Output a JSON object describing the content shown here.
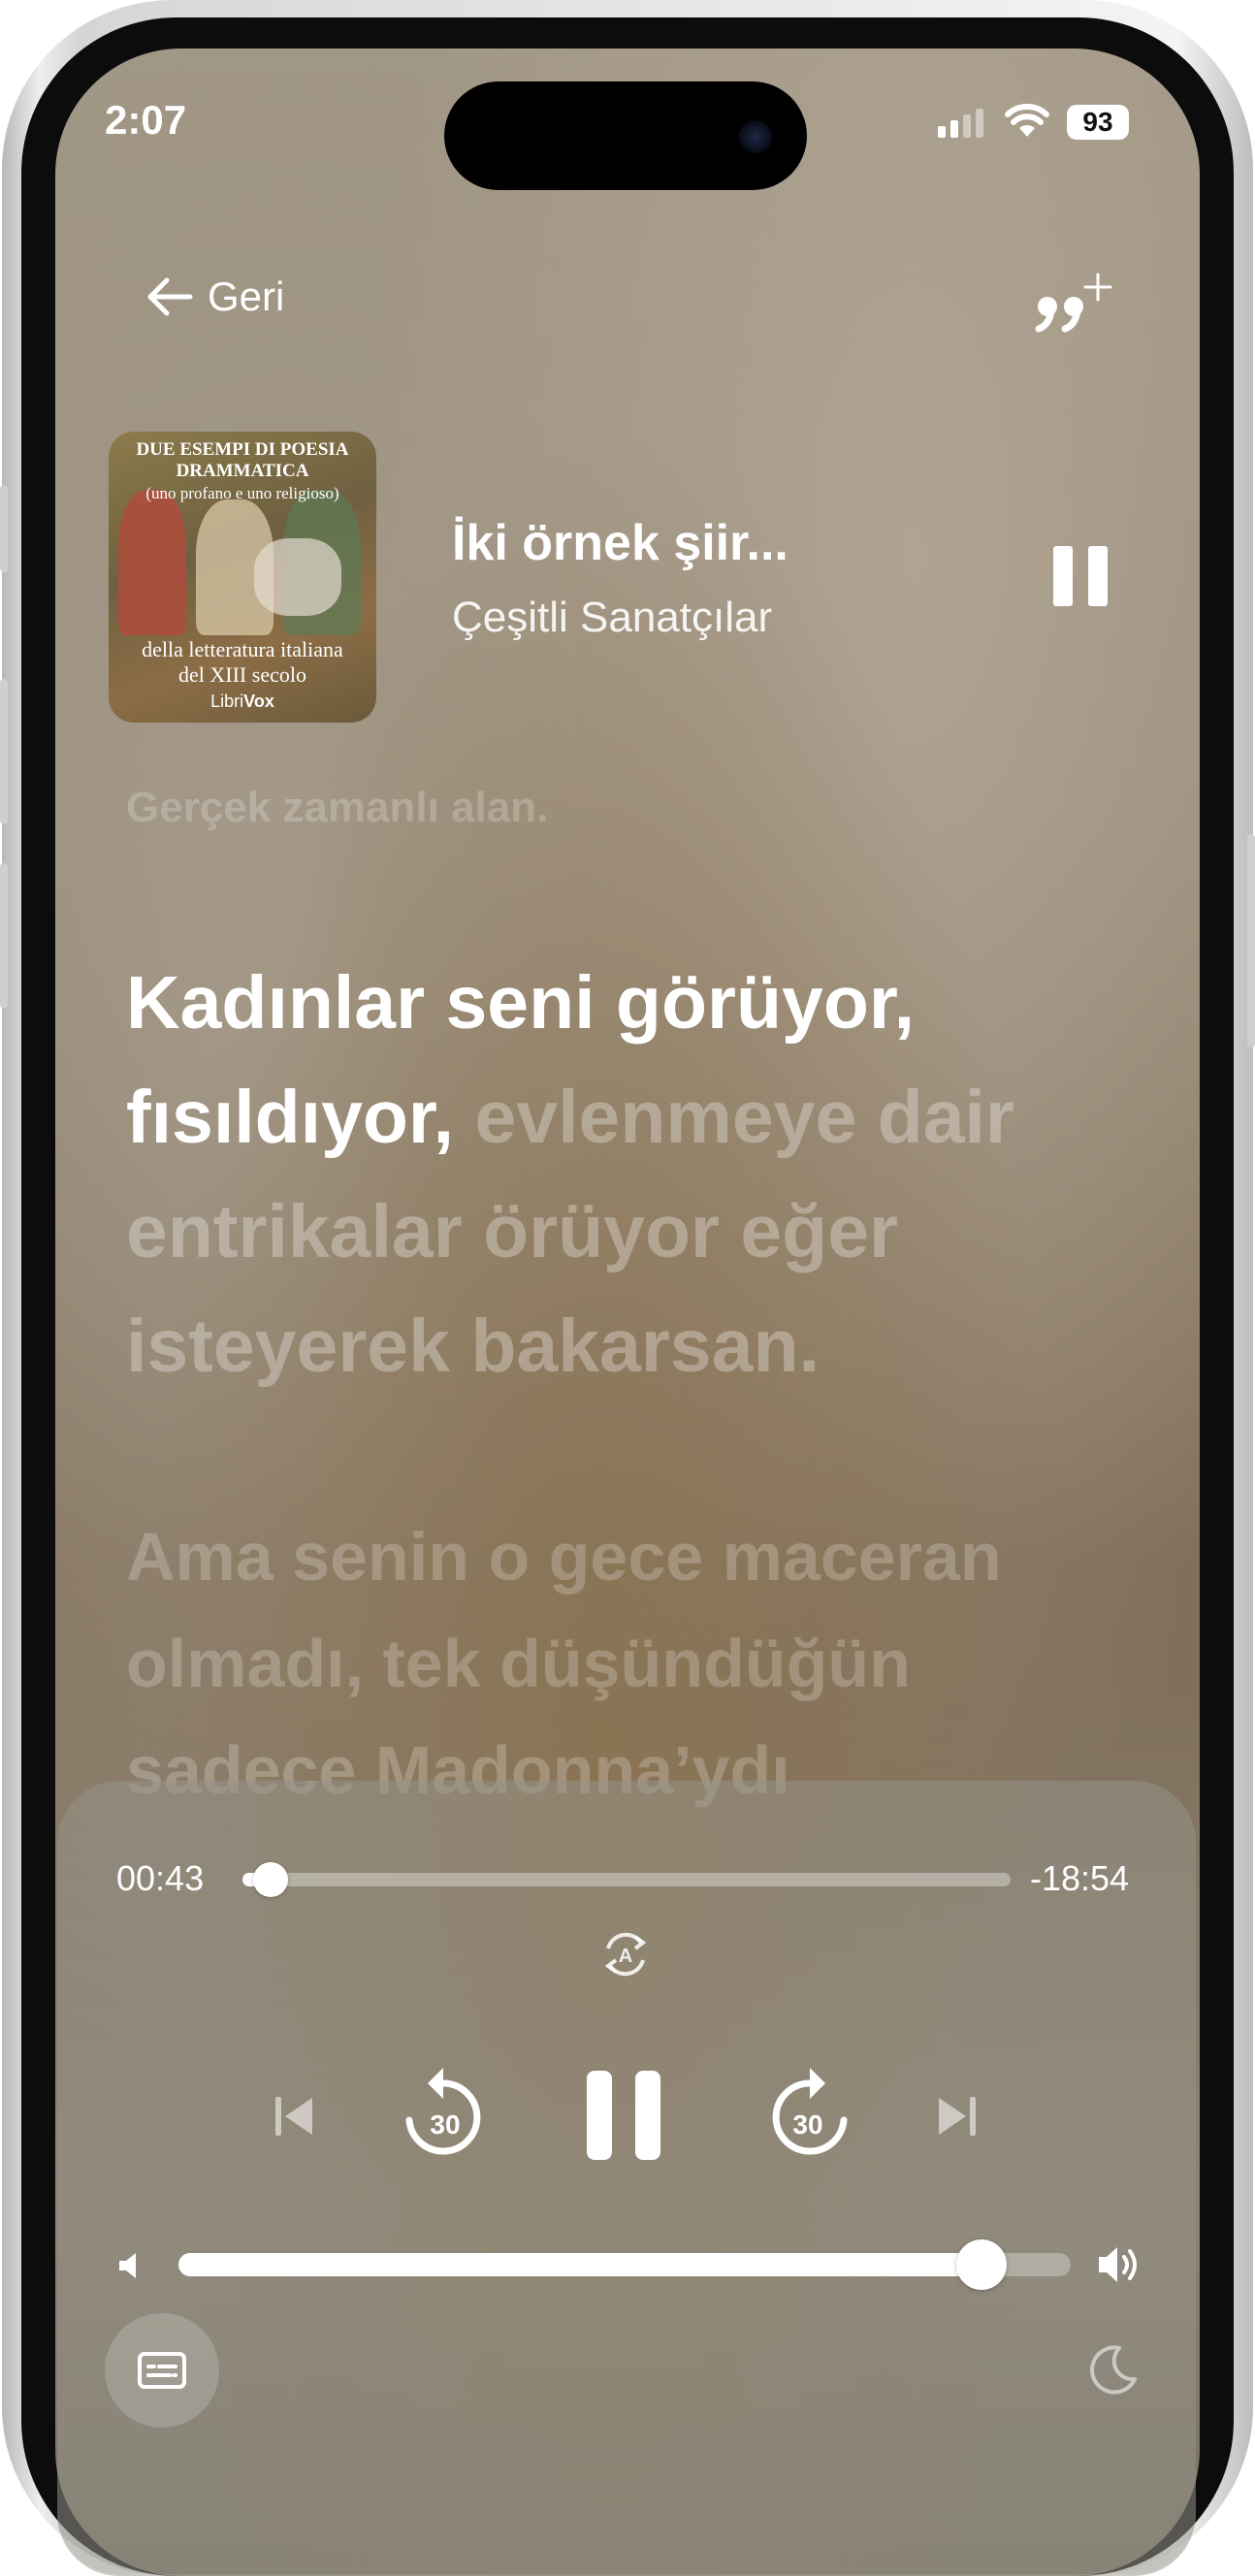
{
  "status_bar": {
    "time": "2:07",
    "battery": "93"
  },
  "nav": {
    "back_label": "Geri"
  },
  "now_playing": {
    "title": "İki örnek şiir...",
    "artist": "Çeşitli Sanatçılar",
    "cover": {
      "line1": "DUE ESEMPI DI POESIA",
      "line2": "DRAMMATICA",
      "line3": "(uno profano e uno religioso)",
      "line4": "della letteratura italiana",
      "line5": "del XIII secolo",
      "brand_a": "Libri",
      "brand_b": "Vox"
    }
  },
  "lyrics": {
    "note": "Gerçek zamanlı alan.",
    "current_sung": "Kadınlar seni görüyor, fısıldıyor,",
    "current_unsung": "evlenmeye dair entrikalar örüyor eğer isteyerek bakarsan.",
    "next": "Ama senin o gece maceran olmadı, tek düşündüğün sadece Madonna’ydı"
  },
  "player": {
    "elapsed": "00:43",
    "remaining": "-18:54",
    "progress_fraction": 0.037,
    "volume_fraction": 0.9,
    "skip_back_seconds": "30",
    "skip_forward_seconds": "30",
    "autoplay_letter": "A"
  }
}
